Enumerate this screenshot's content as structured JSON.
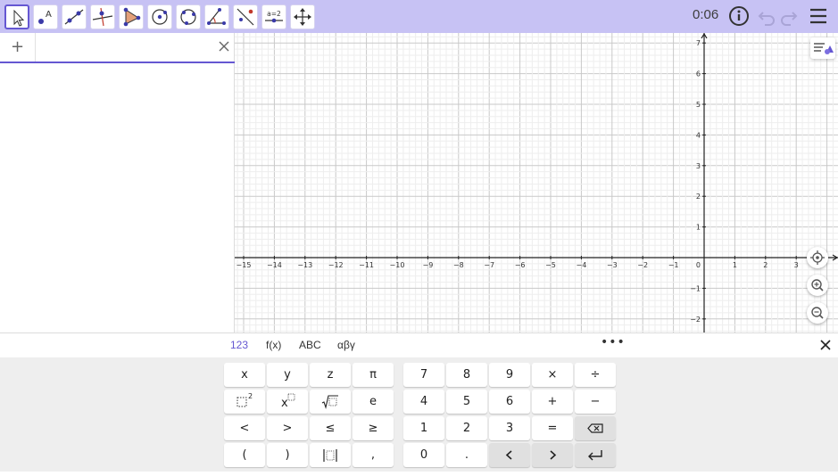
{
  "toolbar": {
    "tools": [
      {
        "name": "move-tool",
        "selected": true
      },
      {
        "name": "point-tool"
      },
      {
        "name": "line-tool"
      },
      {
        "name": "perpendicular-line-tool"
      },
      {
        "name": "polygon-tool"
      },
      {
        "name": "circle-center-point-tool"
      },
      {
        "name": "circle-three-points-tool"
      },
      {
        "name": "angle-tool"
      },
      {
        "name": "reflect-line-tool"
      },
      {
        "name": "slider-tool",
        "label": "a=2"
      },
      {
        "name": "move-graphics-tool"
      }
    ],
    "timer": "0:06"
  },
  "algebra": {
    "add_label": "+"
  },
  "graphics": {
    "x_ticks": [
      "−15",
      "−14",
      "−13",
      "−12",
      "−11",
      "−10",
      "−9",
      "−8",
      "−7",
      "−6",
      "−5",
      "−4",
      "−3",
      "−2",
      "−1",
      "0",
      "1",
      "2",
      "3"
    ],
    "y_ticks_pos": [
      "7",
      "6",
      "5",
      "4",
      "3",
      "2",
      "1"
    ],
    "y_ticks_neg": [
      "−1",
      "−2"
    ]
  },
  "keyboard": {
    "tabs": [
      "123",
      "f(x)",
      "ABC",
      "αβγ"
    ],
    "active_tab": "123",
    "more_label": "•••",
    "keys": {
      "row1": [
        "x",
        "y",
        "z",
        "π",
        "7",
        "8",
        "9",
        "×",
        "÷"
      ],
      "row2": [
        "e",
        "4",
        "5",
        "6",
        "+",
        "−"
      ],
      "row3": [
        "<",
        ">",
        "≤",
        "≥",
        "1",
        "2",
        "3",
        "="
      ],
      "row4": [
        "(",
        ")",
        ",",
        "0",
        "."
      ]
    }
  },
  "colors": {
    "accent": "#6557d2",
    "toolbar_bg": "#c7c2f4",
    "keyboard_bg": "#eeeeee"
  }
}
